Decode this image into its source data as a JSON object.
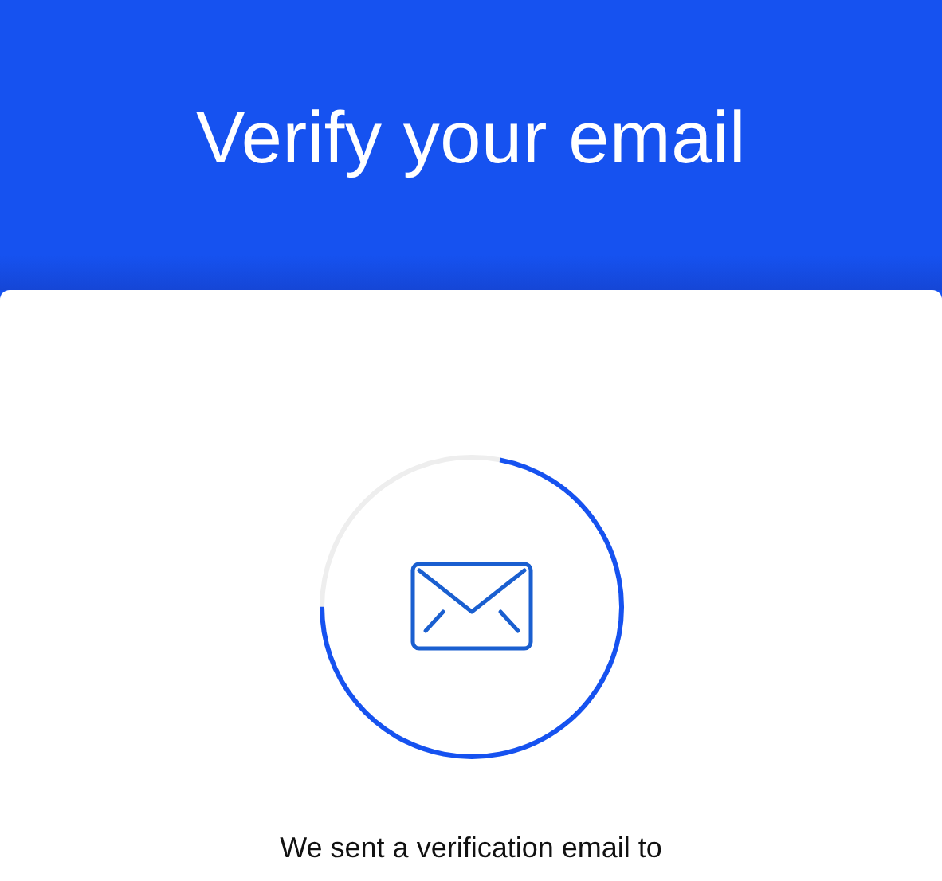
{
  "header": {
    "title": "Verify your email"
  },
  "progress": {
    "level": 0.72
  },
  "message": "We sent a verification email to"
}
